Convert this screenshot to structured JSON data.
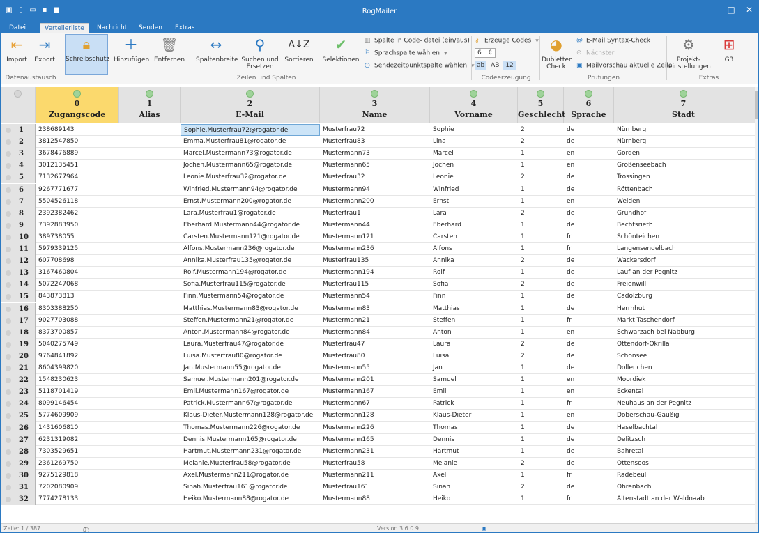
{
  "app": {
    "title": "RogMailer"
  },
  "tabs": [
    {
      "label": "Datei",
      "active": false
    },
    {
      "label": "Verteilerliste",
      "active": true
    },
    {
      "label": "Nachricht",
      "active": false
    },
    {
      "label": "Senden",
      "active": false
    },
    {
      "label": "Extras",
      "active": false
    }
  ],
  "ribbon": {
    "import": "Import",
    "export": "Export",
    "schreibschutz": "Schreibschutz",
    "hinzufuegen": "Hinzufügen",
    "entfernen": "Entfernen",
    "spaltenbreite": "Spaltenbreite",
    "suchen": "Suchen und Ersetzen",
    "sortieren": "Sortieren",
    "selektionen": "Selektionen",
    "spalte_code": "Spalte in Code- datei (ein/aus)",
    "sprachspalte": "Sprachspalte wählen",
    "sendezeit": "Sendezeitpunktspalte wählen",
    "erzeuge_codes": "Erzeuge Codes",
    "code_length": "6",
    "code_opt_ab": "ab",
    "code_opt_AB": "AB",
    "code_opt_12": "12",
    "dubletten": "Dubletten Check",
    "email_syntax": "E-Mail Syntax-Check",
    "naechster": "Nächster",
    "mailvorschau": "Mailvorschau aktuelle Zeile",
    "projekt": "Projekt- einstellungen",
    "g3": "G3",
    "groups": {
      "datenaustausch": "Datenaustausch",
      "zeilen_spalten": "Zeilen und Spalten",
      "codeerzeugung": "Codeerzeugung",
      "pruefungen": "Prüfungen",
      "extras": "Extras"
    }
  },
  "columns": [
    {
      "num": "0",
      "name": "Zugangscode"
    },
    {
      "num": "1",
      "name": "Alias"
    },
    {
      "num": "2",
      "name": "E-Mail"
    },
    {
      "num": "3",
      "name": "Name"
    },
    {
      "num": "4",
      "name": "Vorname"
    },
    {
      "num": "5",
      "name": "Geschlecht"
    },
    {
      "num": "6",
      "name": "Sprache"
    },
    {
      "num": "7",
      "name": "Stadt"
    }
  ],
  "rows": [
    {
      "n": "1",
      "code": "238689143",
      "alias": "",
      "email": "Sophie.Musterfrau72@rogator.de",
      "name": "Musterfrau72",
      "vorname": "Sophie",
      "g": "2",
      "lang": "de",
      "stadt": "Nürnberg"
    },
    {
      "n": "2",
      "code": "3812547850",
      "alias": "",
      "email": "Emma.Musterfrau81@rogator.de",
      "name": "Musterfrau83",
      "vorname": "Lina",
      "g": "2",
      "lang": "de",
      "stadt": "Nürnberg"
    },
    {
      "n": "3",
      "code": "3678476889",
      "alias": "",
      "email": "Marcel.Mustermann73@rogator.de",
      "name": "Mustermann73",
      "vorname": "Marcel",
      "g": "1",
      "lang": "en",
      "stadt": "Gorden"
    },
    {
      "n": "4",
      "code": "3012135451",
      "alias": "",
      "email": "Jochen.Mustermann65@rogator.de",
      "name": "Mustermann65",
      "vorname": "Jochen",
      "g": "1",
      "lang": "en",
      "stadt": "Großenseebach"
    },
    {
      "n": "5",
      "code": "7132677964",
      "alias": "",
      "email": "Leonie.Musterfrau32@rogator.de",
      "name": "Musterfrau32",
      "vorname": "Leonie",
      "g": "2",
      "lang": "de",
      "stadt": "Trossingen"
    },
    {
      "n": "6",
      "code": "9267771677",
      "alias": "",
      "email": "Winfried.Mustermann94@rogator.de",
      "name": "Mustermann94",
      "vorname": "Winfried",
      "g": "1",
      "lang": "de",
      "stadt": "Röttenbach"
    },
    {
      "n": "7",
      "code": "5504526118",
      "alias": "",
      "email": "Ernst.Mustermann200@rogator.de",
      "name": "Mustermann200",
      "vorname": "Ernst",
      "g": "1",
      "lang": "en",
      "stadt": "Weiden"
    },
    {
      "n": "8",
      "code": "2392382462",
      "alias": "",
      "email": "Lara.Musterfrau1@rogator.de",
      "name": "Musterfrau1",
      "vorname": "Lara",
      "g": "2",
      "lang": "de",
      "stadt": "Grundhof"
    },
    {
      "n": "9",
      "code": "7392883950",
      "alias": "",
      "email": "Eberhard.Mustermann44@rogator.de",
      "name": "Mustermann44",
      "vorname": "Eberhard",
      "g": "1",
      "lang": "de",
      "stadt": "Bechtsrieth"
    },
    {
      "n": "10",
      "code": "389738055",
      "alias": "",
      "email": "Carsten.Mustermann121@rogator.de",
      "name": "Mustermann121",
      "vorname": "Carsten",
      "g": "1",
      "lang": "fr",
      "stadt": "Schönteichen"
    },
    {
      "n": "11",
      "code": "5979339125",
      "alias": "",
      "email": "Alfons.Mustermann236@rogator.de",
      "name": "Mustermann236",
      "vorname": "Alfons",
      "g": "1",
      "lang": "fr",
      "stadt": "Langensendelbach"
    },
    {
      "n": "12",
      "code": "607708698",
      "alias": "",
      "email": "Annika.Musterfrau135@rogator.de",
      "name": "Musterfrau135",
      "vorname": "Annika",
      "g": "2",
      "lang": "de",
      "stadt": "Wackersdorf"
    },
    {
      "n": "13",
      "code": "3167460804",
      "alias": "",
      "email": "Rolf.Mustermann194@rogator.de",
      "name": "Mustermann194",
      "vorname": "Rolf",
      "g": "1",
      "lang": "de",
      "stadt": "Lauf an der Pegnitz"
    },
    {
      "n": "14",
      "code": "5072247068",
      "alias": "",
      "email": "Sofia.Musterfrau115@rogator.de",
      "name": "Musterfrau115",
      "vorname": "Sofia",
      "g": "2",
      "lang": "de",
      "stadt": "Freienwill"
    },
    {
      "n": "15",
      "code": "843873813",
      "alias": "",
      "email": "Finn.Mustermann54@rogator.de",
      "name": "Mustermann54",
      "vorname": "Finn",
      "g": "1",
      "lang": "de",
      "stadt": "Cadolzburg"
    },
    {
      "n": "16",
      "code": "8303388250",
      "alias": "",
      "email": "Matthias.Mustermann83@rogator.de",
      "name": "Mustermann83",
      "vorname": "Matthias",
      "g": "1",
      "lang": "de",
      "stadt": "Herrnhut"
    },
    {
      "n": "17",
      "code": "9027703088",
      "alias": "",
      "email": "Steffen.Mustermann21@rogator.de",
      "name": "Mustermann21",
      "vorname": "Steffen",
      "g": "1",
      "lang": "fr",
      "stadt": "Markt Taschendorf"
    },
    {
      "n": "18",
      "code": "8373700857",
      "alias": "",
      "email": "Anton.Mustermann84@rogator.de",
      "name": "Mustermann84",
      "vorname": "Anton",
      "g": "1",
      "lang": "en",
      "stadt": "Schwarzach bei Nabburg"
    },
    {
      "n": "19",
      "code": "5040275749",
      "alias": "",
      "email": "Laura.Musterfrau47@rogator.de",
      "name": "Musterfrau47",
      "vorname": "Laura",
      "g": "2",
      "lang": "de",
      "stadt": "Ottendorf-Okrilla"
    },
    {
      "n": "20",
      "code": "9764841892",
      "alias": "",
      "email": "Luisa.Musterfrau80@rogator.de",
      "name": "Musterfrau80",
      "vorname": "Luisa",
      "g": "2",
      "lang": "de",
      "stadt": "Schönsee"
    },
    {
      "n": "21",
      "code": "8604399820",
      "alias": "",
      "email": "Jan.Mustermann55@rogator.de",
      "name": "Mustermann55",
      "vorname": "Jan",
      "g": "1",
      "lang": "de",
      "stadt": "Dollenchen"
    },
    {
      "n": "22",
      "code": "1548230623",
      "alias": "",
      "email": "Samuel.Mustermann201@rogator.de",
      "name": "Mustermann201",
      "vorname": "Samuel",
      "g": "1",
      "lang": "en",
      "stadt": "Moordiek"
    },
    {
      "n": "23",
      "code": "5118701419",
      "alias": "",
      "email": "Emil.Mustermann167@rogator.de",
      "name": "Mustermann167",
      "vorname": "Emil",
      "g": "1",
      "lang": "en",
      "stadt": "Eckental"
    },
    {
      "n": "24",
      "code": "8099146454",
      "alias": "",
      "email": "Patrick.Mustermann67@rogator.de",
      "name": "Mustermann67",
      "vorname": "Patrick",
      "g": "1",
      "lang": "fr",
      "stadt": "Neuhaus an der Pegnitz"
    },
    {
      "n": "25",
      "code": "5774609909",
      "alias": "",
      "email": "Klaus-Dieter.Mustermann128@rogator.de",
      "name": "Mustermann128",
      "vorname": "Klaus-Dieter",
      "g": "1",
      "lang": "en",
      "stadt": "Doberschau-Gaußig"
    },
    {
      "n": "26",
      "code": "1431606810",
      "alias": "",
      "email": "Thomas.Mustermann226@rogator.de",
      "name": "Mustermann226",
      "vorname": "Thomas",
      "g": "1",
      "lang": "de",
      "stadt": "Haselbachtal"
    },
    {
      "n": "27",
      "code": "6231319082",
      "alias": "",
      "email": "Dennis.Mustermann165@rogator.de",
      "name": "Mustermann165",
      "vorname": "Dennis",
      "g": "1",
      "lang": "de",
      "stadt": "Delitzsch"
    },
    {
      "n": "28",
      "code": "7303529651",
      "alias": "",
      "email": "Hartmut.Mustermann231@rogator.de",
      "name": "Mustermann231",
      "vorname": "Hartmut",
      "g": "1",
      "lang": "de",
      "stadt": "Bahretal"
    },
    {
      "n": "29",
      "code": "2361269750",
      "alias": "",
      "email": "Melanie.Musterfrau58@rogator.de",
      "name": "Musterfrau58",
      "vorname": "Melanie",
      "g": "2",
      "lang": "de",
      "stadt": "Ottensoos"
    },
    {
      "n": "30",
      "code": "9275129818",
      "alias": "",
      "email": "Axel.Mustermann211@rogator.de",
      "name": "Mustermann211",
      "vorname": "Axel",
      "g": "1",
      "lang": "fr",
      "stadt": "Radebeul"
    },
    {
      "n": "31",
      "code": "7202080909",
      "alias": "",
      "email": "Sinah.Musterfrau161@rogator.de",
      "name": "Musterfrau161",
      "vorname": "Sinah",
      "g": "2",
      "lang": "de",
      "stadt": "Ohrenbach"
    },
    {
      "n": "32",
      "code": "7774278133",
      "alias": "",
      "email": "Heiko.Mustermann88@rogator.de",
      "name": "Mustermann88",
      "vorname": "Heiko",
      "g": "1",
      "lang": "fr",
      "stadt": "Altenstadt an der Waldnaab"
    }
  ],
  "status": {
    "zeile": "Zeile: 1 / 387",
    "count": "0",
    "version": "Version 3.6.0.9"
  }
}
